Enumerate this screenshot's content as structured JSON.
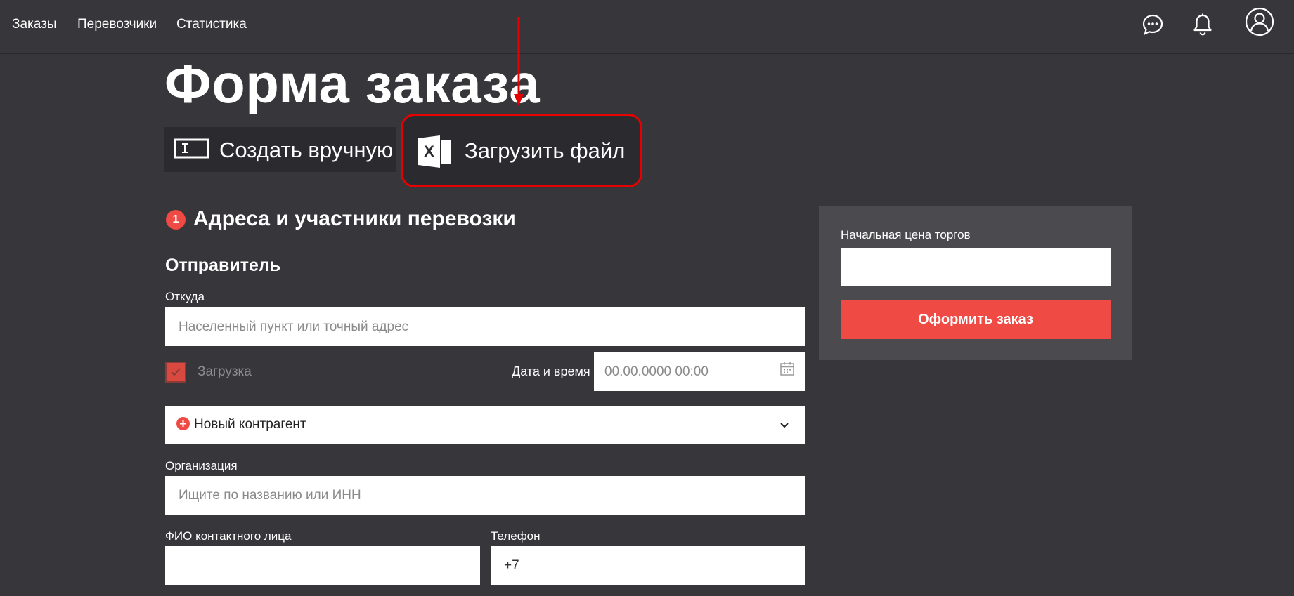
{
  "nav": {
    "items": [
      {
        "label": "Заказы"
      },
      {
        "label": "Перевозчики"
      },
      {
        "label": "Статистика"
      }
    ],
    "icons": [
      "chat-icon",
      "bell-icon",
      "user-icon"
    ]
  },
  "page": {
    "title": "Форма заказа"
  },
  "modes": {
    "manual": {
      "label": "Создать вручную",
      "icon": "text-field-icon"
    },
    "upload": {
      "label": "Загрузить файл",
      "icon": "excel-icon"
    }
  },
  "section1": {
    "step": "1",
    "title": "Адреса и участники перевозки",
    "sender": {
      "title": "Отправитель",
      "from_label": "Откуда",
      "from_placeholder": "Населенный пункт или точный адрес",
      "loading_label": "Загрузка",
      "loading_checked": true,
      "datetime_label": "Дата и время",
      "datetime_placeholder": "00.00.0000 00:00",
      "counterparty_label": "Новый контрагент",
      "organization_label": "Организация",
      "organization_placeholder": "Ищите по названию или ИНН",
      "contact_label": "ФИО контактного лица",
      "contact_value": "",
      "phone_label": "Телефон",
      "phone_value": "+7"
    }
  },
  "sidebar": {
    "price_label": "Начальная цена торгов",
    "price_value": "",
    "submit_label": "Оформить заказ"
  },
  "colors": {
    "background": "#36363b",
    "panel": "#4a4a4f",
    "accent": "#ef4a43",
    "highlight_border": "#e60000"
  }
}
